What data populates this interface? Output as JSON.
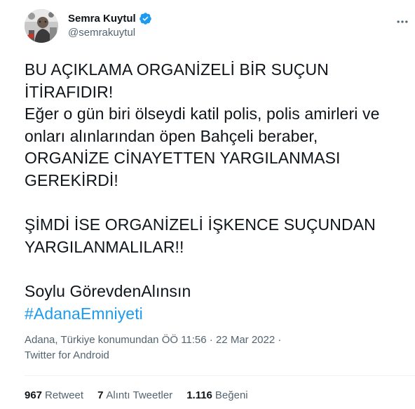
{
  "author": {
    "name": "Semra Kuytul",
    "handle": "@semrakuytul",
    "verified_color": "#1d9bf0"
  },
  "tweet": {
    "lines": [
      "BU AÇIKLAMA ORGANİZELİ BİR SUÇUN",
      "İTİRAFIDIR!",
      "Eğer o gün biri ölseydi katil polis, polis amirleri ve",
      "onları alınlarından öpen Bahçeli beraber,",
      "ORGANİZE CİNAYETTEN YARGILANMASI",
      "GEREKİRDİ!",
      "",
      "ŞİMDİ İSE ORGANİZELİ İŞKENCE SUÇUNDAN",
      "YARGILANMALILAR!!",
      "",
      "Soylu GörevdenAlınsın"
    ],
    "hashtag": "#AdanaEmniyeti"
  },
  "meta": {
    "location": "Adana, Türkiye konumundan",
    "time": "ÖÖ 11:56",
    "separator": "·",
    "date": "22 Mar 2022",
    "source": "Twitter for Android"
  },
  "stats": {
    "retweets_count": "967",
    "retweets_label": "Retweet",
    "quotes_count": "7",
    "quotes_label": "Alıntı Tweetler",
    "likes_count": "1.116",
    "likes_label": "Beğeni"
  },
  "icons": {
    "verified": "verified-badge-icon",
    "more": "more-options-icon"
  },
  "colors": {
    "text": "#0f1419",
    "secondary": "#536471",
    "accent": "#1d9bf0",
    "divider": "#eff3f4"
  }
}
